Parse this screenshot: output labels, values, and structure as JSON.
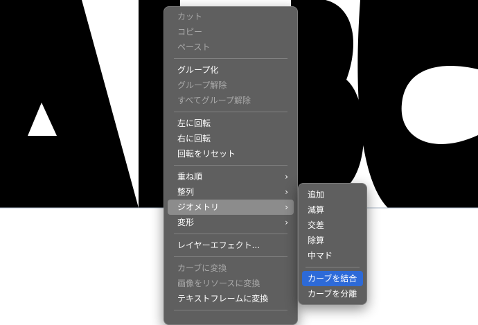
{
  "canvas": {
    "artwork_text": "ABC",
    "guide_color": "#a7b6c6"
  },
  "context_menu": {
    "items": [
      {
        "id": "cut",
        "label": "カット",
        "enabled": false
      },
      {
        "id": "copy",
        "label": "コピー",
        "enabled": false
      },
      {
        "id": "paste",
        "label": "ペースト",
        "enabled": false
      },
      {
        "id": "group",
        "label": "グループ化",
        "enabled": true
      },
      {
        "id": "ungroup",
        "label": "グループ解除",
        "enabled": false
      },
      {
        "id": "ungroup-all",
        "label": "すべてグループ解除",
        "enabled": false
      },
      {
        "id": "rotate-left",
        "label": "左に回転",
        "enabled": true
      },
      {
        "id": "rotate-right",
        "label": "右に回転",
        "enabled": true
      },
      {
        "id": "reset-rotation",
        "label": "回転をリセット",
        "enabled": true
      },
      {
        "id": "order",
        "label": "重ね順",
        "enabled": true,
        "submenu": true
      },
      {
        "id": "align",
        "label": "整列",
        "enabled": true,
        "submenu": true
      },
      {
        "id": "geometry",
        "label": "ジオメトリ",
        "enabled": true,
        "submenu": true,
        "highlighted": true
      },
      {
        "id": "transform",
        "label": "変形",
        "enabled": true,
        "submenu": true
      },
      {
        "id": "layer-effects",
        "label": "レイヤーエフェクト...",
        "enabled": true
      },
      {
        "id": "convert-to-curves",
        "label": "カーブに変換",
        "enabled": false
      },
      {
        "id": "image-to-resource",
        "label": "画像をリソースに変換",
        "enabled": false
      },
      {
        "id": "convert-to-text-frame",
        "label": "テキストフレームに変換",
        "enabled": true
      }
    ],
    "chevron": "›"
  },
  "geometry_submenu": {
    "items": [
      {
        "id": "add",
        "label": "追加"
      },
      {
        "id": "subtract",
        "label": "減算"
      },
      {
        "id": "intersect",
        "label": "交差"
      },
      {
        "id": "divide",
        "label": "除算"
      },
      {
        "id": "xor",
        "label": "中マド"
      },
      {
        "id": "combine-curves",
        "label": "カーブを結合",
        "selected": true
      },
      {
        "id": "separate-curves",
        "label": "カーブを分離"
      }
    ]
  },
  "colors": {
    "menu_bg": "#5f5f5f",
    "highlight": "#8c8c8c",
    "selected": "#2d6ad8",
    "disabled_text": "#a9a9a9"
  }
}
